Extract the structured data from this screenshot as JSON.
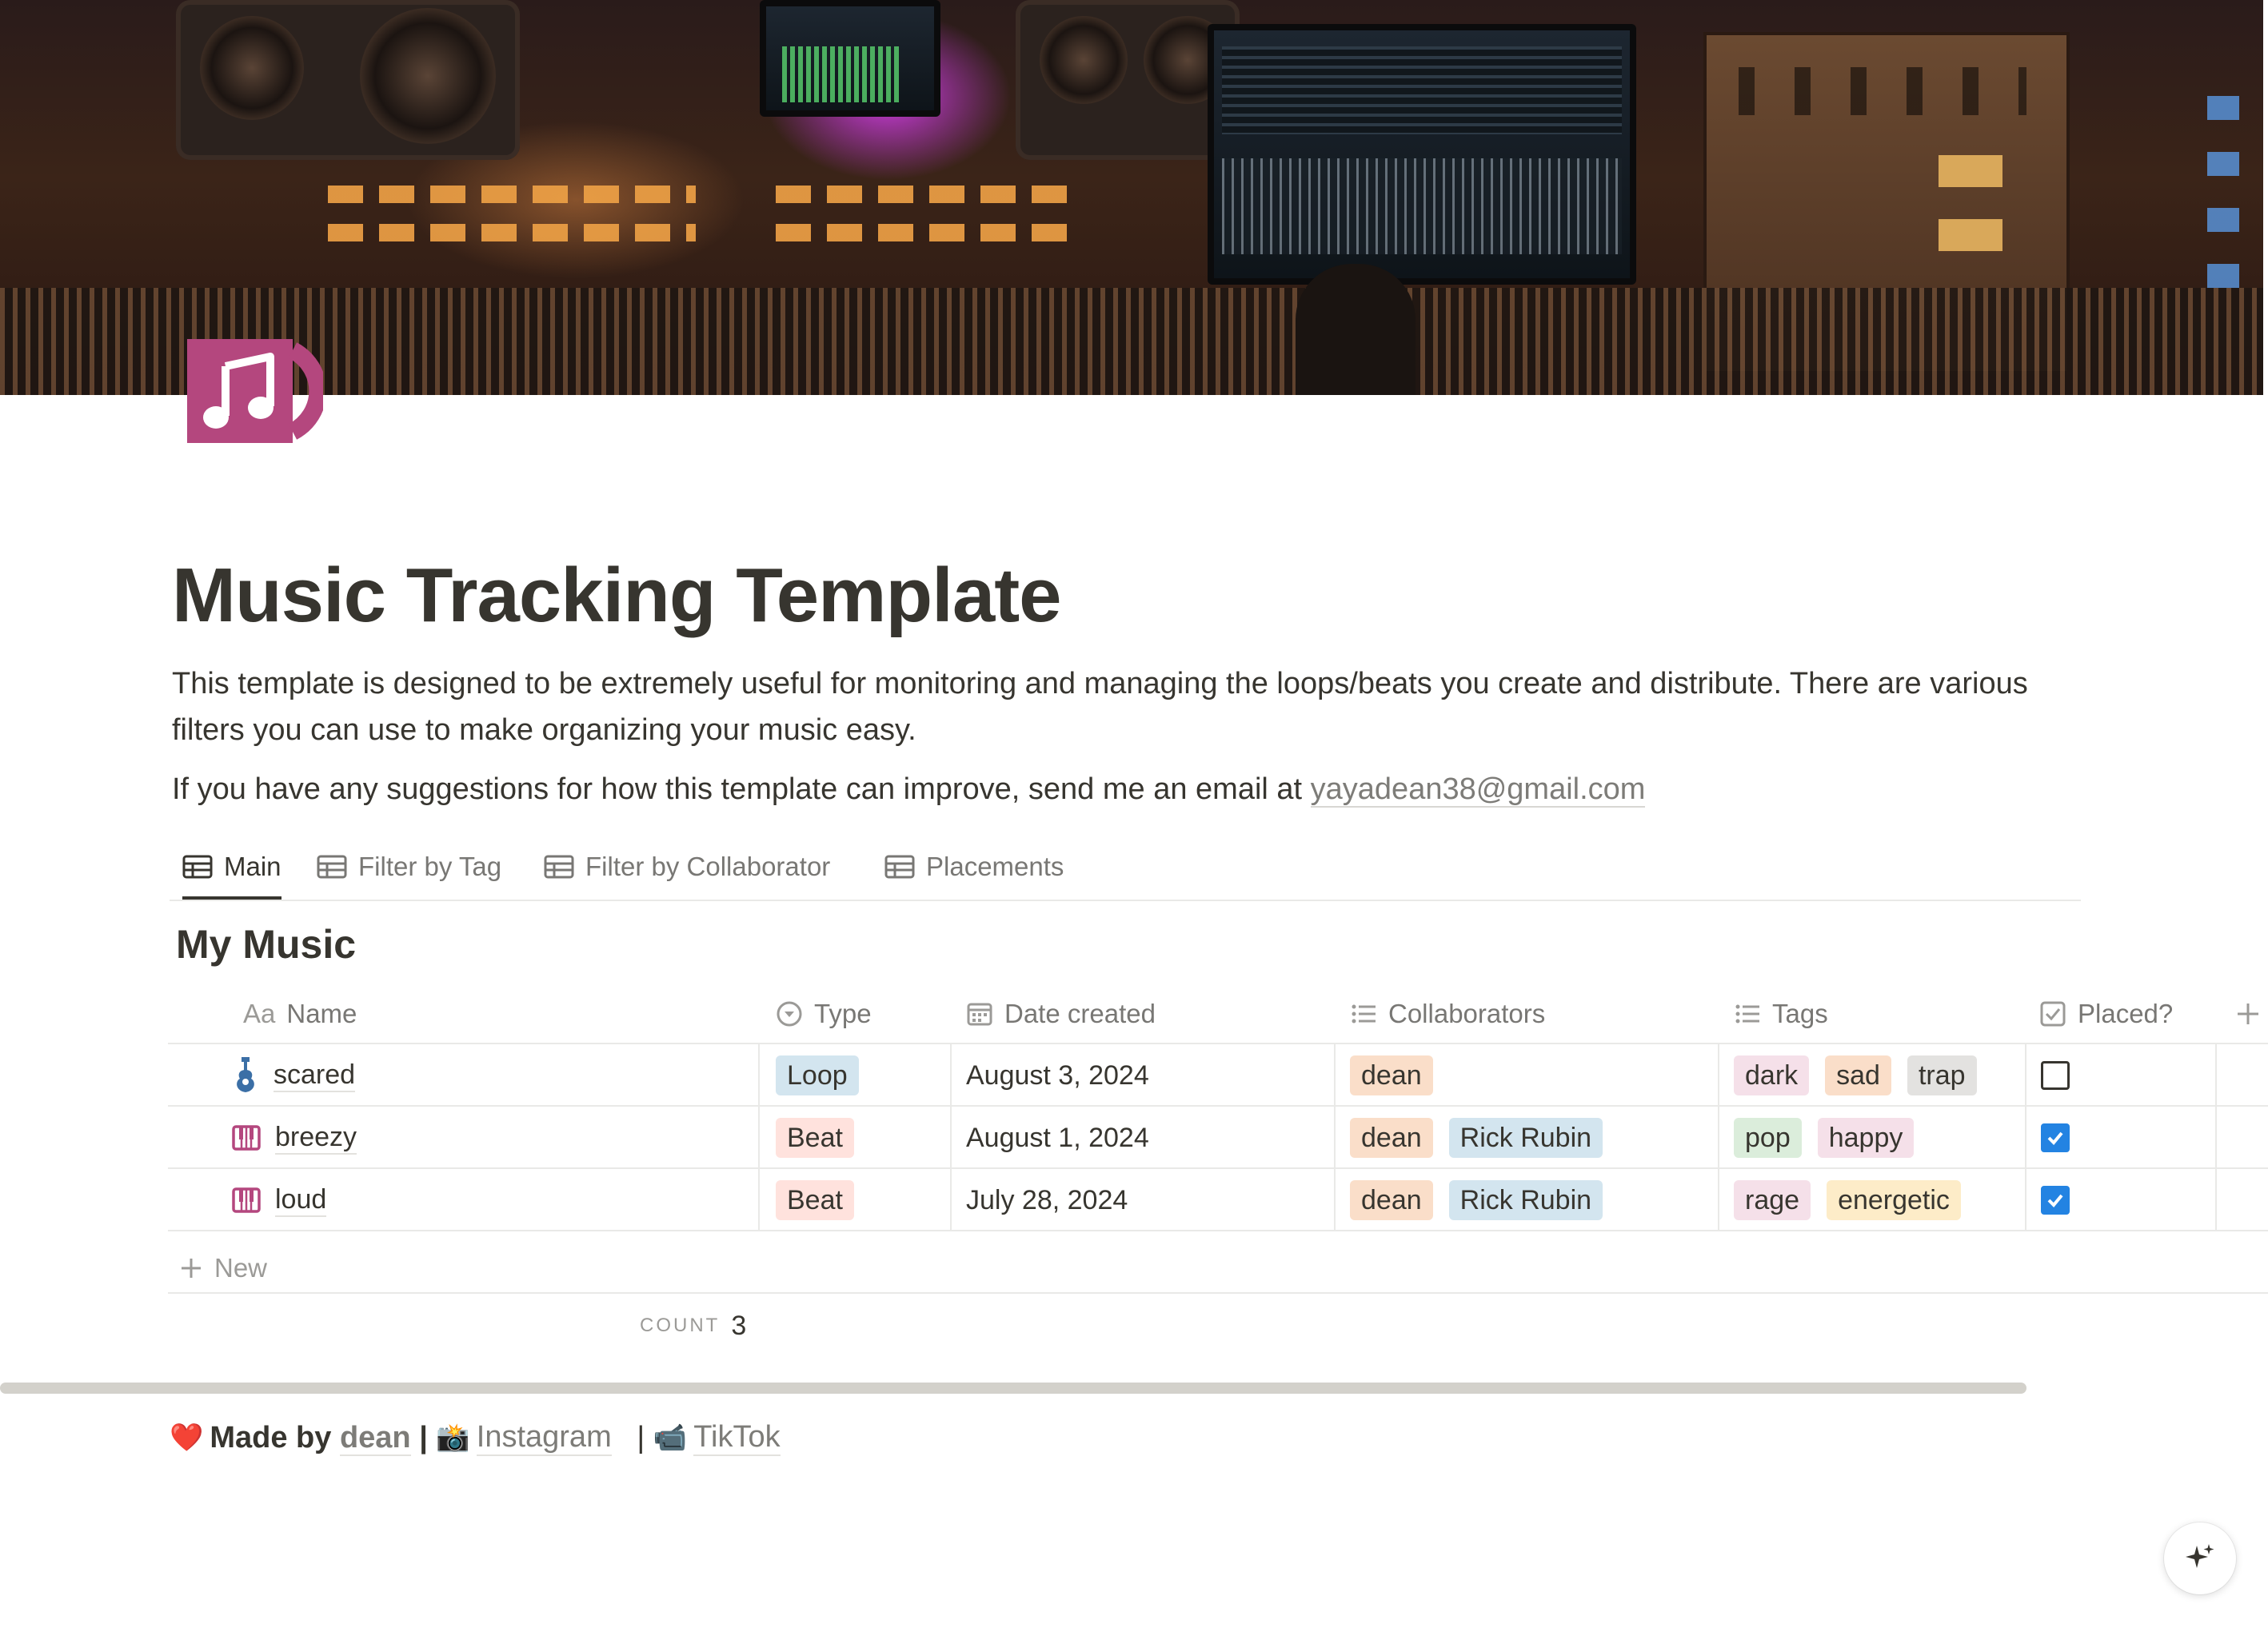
{
  "page": {
    "title": "Music Tracking Template",
    "description": "This template is designed to be extremely useful for monitoring and managing the loops/beats you create and distribute. There are various filters you can use to make organizing your music easy.",
    "suggestion_text": "If you have any suggestions for how this template can improve, send me an email at ",
    "email": "yayadean38@gmail.com"
  },
  "tabs": [
    {
      "label": "Main",
      "active": true
    },
    {
      "label": "Filter by Tag",
      "active": false
    },
    {
      "label": "Filter by Collaborator",
      "active": false
    },
    {
      "label": "Placements",
      "active": false
    }
  ],
  "database": {
    "title": "My Music",
    "columns": {
      "name_prefix": "Aa",
      "name": "Name",
      "type": "Type",
      "date": "Date created",
      "collaborators": "Collaborators",
      "tags": "Tags",
      "placed": "Placed?"
    },
    "rows": [
      {
        "icon": "guitar-icon",
        "name": "scared",
        "type": "Loop",
        "date": "August 3, 2024",
        "collaborators": [
          "dean"
        ],
        "tags": [
          "dark",
          "sad",
          "trap"
        ],
        "placed": false
      },
      {
        "icon": "piano-keys-icon",
        "name": "breezy",
        "type": "Beat",
        "date": "August 1, 2024",
        "collaborators": [
          "dean",
          "Rick Rubin"
        ],
        "tags": [
          "pop",
          "happy"
        ],
        "placed": true
      },
      {
        "icon": "piano-keys-icon",
        "name": "loud",
        "type": "Beat",
        "date": "July 28, 2024",
        "collaborators": [
          "dean",
          "Rick Rubin"
        ],
        "tags": [
          "rage",
          "energetic"
        ],
        "placed": true
      }
    ],
    "new_label": "New",
    "count_label": "COUNT",
    "count_value": "3"
  },
  "footer": {
    "heart": "❤️",
    "made_by": "Made by",
    "author": "dean",
    "separator": "|",
    "instagram_emoji": "📸",
    "instagram": "Instagram",
    "tiktok_emoji": "📹",
    "tiktok": "TikTok"
  },
  "colors": {
    "icon_magenta": "#b4477e",
    "checkbox_blue": "#2383e2",
    "text": "#37352f",
    "muted": "#787774"
  }
}
